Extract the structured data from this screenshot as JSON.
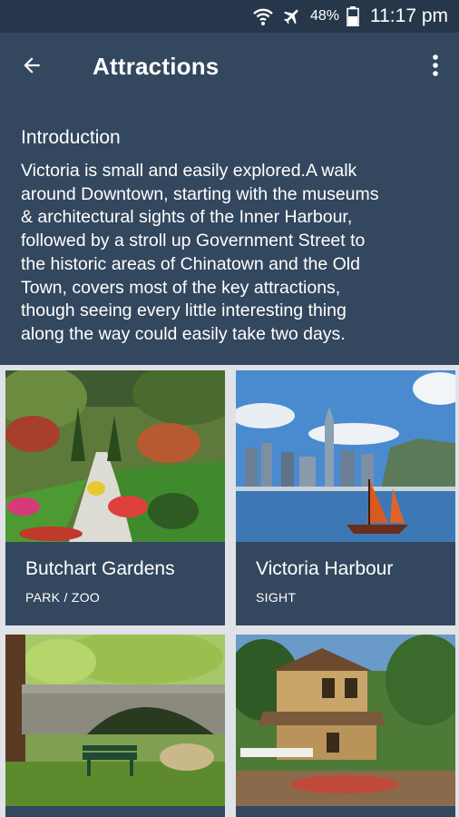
{
  "status_bar": {
    "wifi_icon": "wifi-icon",
    "airplane_icon": "airplane-icon",
    "battery_percent": "48%",
    "battery_icon": "battery-icon",
    "time": "11:17 pm"
  },
  "app_bar": {
    "back_icon": "arrow-back-icon",
    "title": "Attractions",
    "more_icon": "more-vert-icon"
  },
  "intro": {
    "heading": "Introduction",
    "lines": [
      "Victoria is small and easily explored.A walk",
      "around Downtown, starting with the museums",
      "& architectural sights of the Inner Harbour,",
      "followed by a stroll up Government Street to",
      "the historic areas of Chinatown and the Old",
      "Town, covers most of the key attractions,",
      "though seeing every little interesting thing",
      "along the way could easily take two days."
    ]
  },
  "attractions": [
    {
      "title": "Butchart Gardens",
      "category": "PARK / ZOO"
    },
    {
      "title": "Victoria Harbour",
      "category": "SIGHT"
    },
    {
      "title": "",
      "category": ""
    },
    {
      "title": "",
      "category": ""
    }
  ],
  "colors": {
    "status_bar": "#26374b",
    "app_bar": "#33475e",
    "background": "#dfe3e7"
  }
}
